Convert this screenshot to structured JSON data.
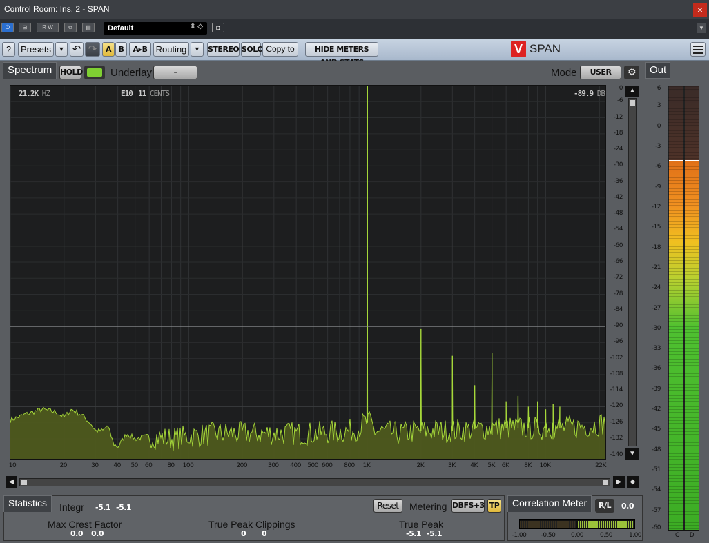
{
  "window": {
    "title": "Control Room: Ins. 2 - SPAN",
    "close_glyph": "×"
  },
  "host": {
    "preset": "Default",
    "buttons": [
      "⏻",
      "⊟",
      "R W",
      "⧉",
      "▤"
    ],
    "camera_glyph": "◘"
  },
  "toolbar": {
    "help": "?",
    "presets": "Presets",
    "dropdown": "▼",
    "undo": "↶",
    "redo": "↷",
    "a": "A",
    "b": "B",
    "ab": "A▸B",
    "routing": "Routing",
    "stereo": "STEREO",
    "solo": "SOLO",
    "copy_to": "Copy to",
    "hide_meters": "HIDE METERS AND STATS",
    "brand": "SPAN",
    "logo": "V"
  },
  "spectrum": {
    "tab": "Spectrum",
    "hold": "HOLD",
    "underlay_label": "Underlay",
    "underlay_value": "–",
    "mode_label": "Mode",
    "mode_value": "USER",
    "gear": "⚙",
    "readout_freq": "21.2K",
    "readout_freq_unit": "HZ",
    "readout_note": "E10",
    "readout_cents": "11",
    "readout_cents_unit": "CENTS",
    "readout_db": "-89.9",
    "readout_db_unit": "DB",
    "db_ticks": [
      "0",
      "-6",
      "-12",
      "-18",
      "-24",
      "-30",
      "-36",
      "-42",
      "-48",
      "-54",
      "-60",
      "-66",
      "-72",
      "-78",
      "-84",
      "-90",
      "-96",
      "-102",
      "-108",
      "-114",
      "-120",
      "-126",
      "-132",
      "-140"
    ],
    "freq_ticks": [
      "10",
      "20",
      "30",
      "40",
      "50",
      "60",
      "80",
      "100",
      "200",
      "300",
      "400",
      "500",
      "600",
      "800",
      "1K",
      "2K",
      "3K",
      "4K",
      "5K",
      "6K",
      "8K",
      "10K",
      "22K"
    ],
    "freq_values": [
      10,
      20,
      30,
      40,
      50,
      60,
      80,
      100,
      200,
      300,
      400,
      500,
      600,
      800,
      1000,
      2000,
      3000,
      4000,
      5000,
      6000,
      8000,
      10000,
      22000
    ],
    "up": "▲",
    "down": "▼",
    "left": "◀",
    "right": "▶",
    "diamond": "◆"
  },
  "chart_data": {
    "type": "area",
    "x_scale": "log",
    "xlim": [
      10,
      22000
    ],
    "ylim": [
      -140,
      0
    ],
    "grid": true,
    "hold_line_db": -90,
    "peaks": [
      {
        "freq": 1000,
        "db": 0
      },
      {
        "freq": 2000,
        "db": -91
      },
      {
        "freq": 3000,
        "db": -101
      },
      {
        "freq": 4000,
        "db": -112
      },
      {
        "freq": 5000,
        "db": -100
      },
      {
        "freq": 6000,
        "db": -118
      },
      {
        "freq": 7000,
        "db": -116
      },
      {
        "freq": 8000,
        "db": -120
      },
      {
        "freq": 9000,
        "db": -118
      },
      {
        "freq": 10000,
        "db": -121
      },
      {
        "freq": 11000,
        "db": -119
      },
      {
        "freq": 12000,
        "db": -120
      }
    ],
    "floor": [
      [
        10,
        -125
      ],
      [
        12,
        -123
      ],
      [
        15,
        -121
      ],
      [
        18,
        -122
      ],
      [
        20,
        -124
      ],
      [
        22,
        -121
      ],
      [
        25,
        -123
      ],
      [
        28,
        -126
      ],
      [
        30,
        -129
      ],
      [
        33,
        -129
      ],
      [
        35,
        -127
      ],
      [
        38,
        -134
      ],
      [
        40,
        -135
      ],
      [
        45,
        -130
      ],
      [
        50,
        -132
      ],
      [
        60,
        -131
      ],
      [
        80,
        -132
      ],
      [
        100,
        -131
      ],
      [
        150,
        -130
      ],
      [
        200,
        -130
      ],
      [
        300,
        -130
      ],
      [
        500,
        -130
      ],
      [
        800,
        -129
      ],
      [
        900,
        -128
      ],
      [
        950,
        -126
      ],
      [
        1050,
        -126
      ],
      [
        1100,
        -129
      ],
      [
        1500,
        -130
      ],
      [
        2000,
        -129
      ],
      [
        3000,
        -129
      ],
      [
        5000,
        -128
      ],
      [
        8000,
        -128
      ],
      [
        12000,
        -128
      ],
      [
        18000,
        -127
      ],
      [
        22000,
        -126
      ]
    ]
  },
  "out": {
    "tab": "Out",
    "scale": [
      "6",
      "3",
      "0",
      "-3",
      "-6",
      "-9",
      "-12",
      "-15",
      "-18",
      "-21",
      "-24",
      "-27",
      "-30",
      "-33",
      "-36",
      "-39",
      "-42",
      "-45",
      "-48",
      "-51",
      "-54",
      "-57",
      "-60"
    ],
    "scale_values": [
      6,
      3,
      0,
      -3,
      -6,
      -9,
      -12,
      -15,
      -18,
      -21,
      -24,
      -27,
      -30,
      -33,
      -36,
      -39,
      -42,
      -45,
      -48,
      -51,
      -54,
      -57,
      -60
    ],
    "level_db": -5.1,
    "peak_db": -5.1,
    "ch_left": "C",
    "ch_right": "D"
  },
  "stats": {
    "tab": "Statistics",
    "integr_label": "Integr",
    "integr_l": "-5.1",
    "integr_r": "-5.1",
    "reset": "Reset",
    "metering_label": "Metering",
    "metering_value": "DBFS+3",
    "tp": "TP",
    "crest_label": "Max Crest Factor",
    "crest_l": "0.0",
    "crest_r": "0.0",
    "clip_label": "True Peak Clippings",
    "clip_l": "0",
    "clip_r": "0",
    "tp_label": "True Peak",
    "tp_l": "-5.1",
    "tp_r": "-5.1"
  },
  "correlation": {
    "tab": "Correlation Meter",
    "rl": "R/L",
    "rl_value": "0.0",
    "value": 0.0,
    "ticks": [
      "-1.00",
      "-0.50",
      "0.00",
      "0.50",
      "1.00"
    ]
  },
  "colors": {
    "spectrum": "#a6d83a",
    "spectrum_fill": "#4e5a1e",
    "accent": "#e0b83a"
  }
}
